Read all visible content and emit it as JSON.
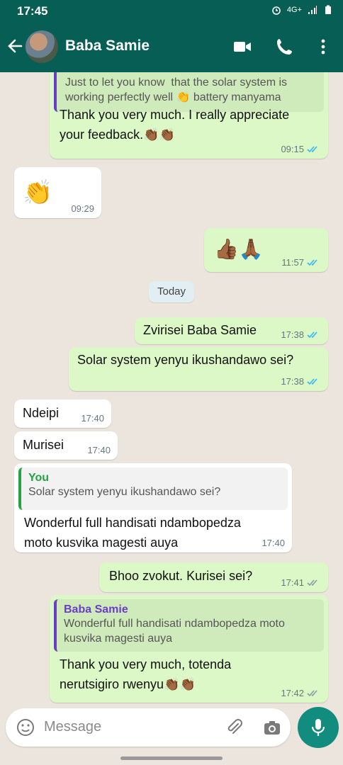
{
  "status_bar": {
    "time": "17:45",
    "network": "4G+"
  },
  "header": {
    "contact_name": "Baba Samie"
  },
  "colors": {
    "header": "#075e54",
    "outgoing": "#dcf8c6",
    "incoming": "#ffffff",
    "read_ticks": "#34b7f1",
    "mic": "#128c7e"
  },
  "messages": [
    {
      "direction": "out",
      "quote_text": "Just to let you know  that the solar system is\nworking perfectly well 👏 battery manyama",
      "text": "Thank you very much. I really appreciate\nyour feedback.👏🏾👏🏾",
      "time": "09:15",
      "status": "read"
    },
    {
      "direction": "in",
      "text": "👏",
      "time": "09:29"
    },
    {
      "direction": "out",
      "text": "👍🏾🙏🏾",
      "time": "11:57",
      "status": "read"
    },
    {
      "direction": "out",
      "text": "Zvirisei Baba Samie",
      "time": "17:38",
      "status": "read"
    },
    {
      "direction": "out",
      "text": "Solar system yenyu ikushandawo sei?",
      "time": "17:38",
      "status": "read"
    },
    {
      "direction": "in",
      "text": "Ndeipi",
      "time": "17:40"
    },
    {
      "direction": "in",
      "text": "Murisei",
      "time": "17:40"
    },
    {
      "direction": "in",
      "quote_name": "You",
      "quote_text": "Solar system yenyu ikushandawo sei?",
      "text": "Wonderful full handisati ndambopedza\nmoto kusvika magesti auya",
      "time": "17:40"
    },
    {
      "direction": "out",
      "text": "Bhoo zvokut. Kurisei sei?",
      "time": "17:41",
      "status": "delivered"
    },
    {
      "direction": "out",
      "quote_name": "Baba Samie",
      "quote_text": "Wonderful full handisati ndambopedza moto\nkusvika magesti auya",
      "text": "Thank you very much, totenda\nnerutsigiro rwenyu👏🏾👏🏾",
      "time": "17:42",
      "status": "delivered"
    }
  ],
  "date_chip": "Today",
  "composer": {
    "placeholder": "Message"
  },
  "icons": [
    "back-arrow-icon",
    "video-call-icon",
    "voice-call-icon",
    "more-options-icon",
    "emoji-icon",
    "attach-icon",
    "camera-icon",
    "mic-icon",
    "alarm-icon",
    "signal-icon",
    "battery-icon"
  ]
}
